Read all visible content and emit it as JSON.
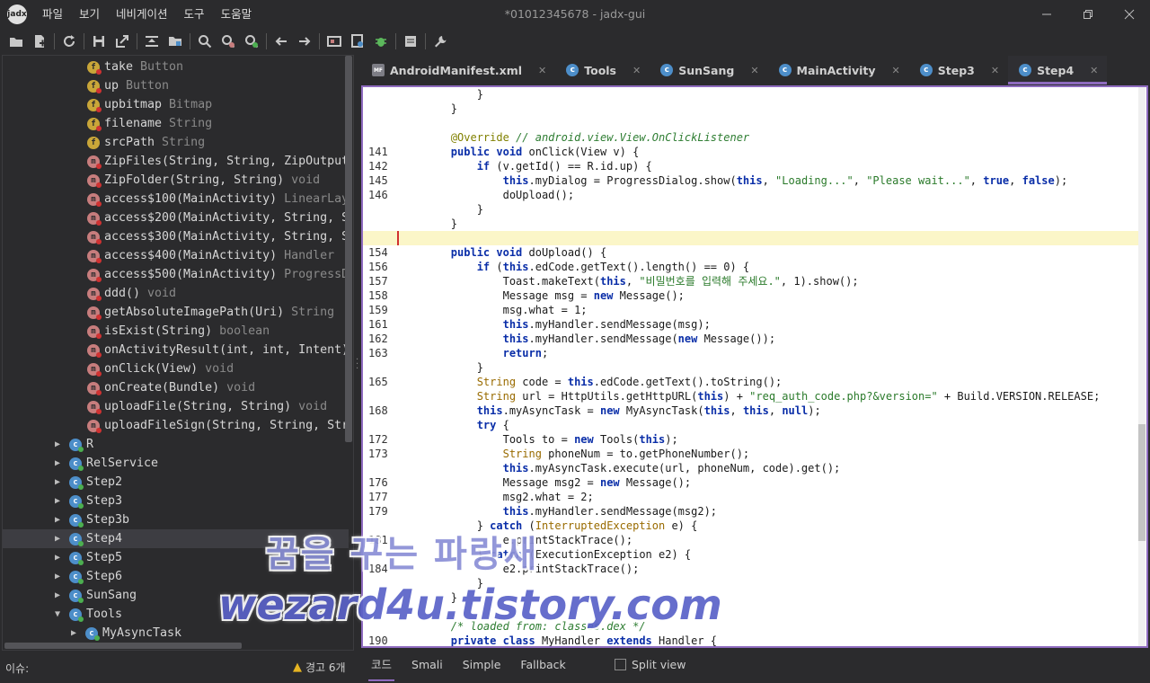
{
  "app": {
    "logo": "jadx",
    "window_title": "*01012345678 - jadx-gui",
    "menu": [
      "파일",
      "보기",
      "네비게이션",
      "도구",
      "도움말"
    ],
    "window_controls": [
      "minimize-icon",
      "restore-icon",
      "close-icon"
    ]
  },
  "toolbar": {
    "icons": [
      "open-folder-icon",
      "add-files-icon",
      "reload-icon",
      "save-icon",
      "export-icon",
      "sync-tree-icon",
      "flatten-packages-icon",
      "search-icon",
      "find-class-icon",
      "find-usage-icon",
      "back-icon",
      "forward-icon",
      "deobfuscation-icon",
      "quark-icon",
      "debugger-icon",
      "log-viewer-icon",
      "preferences-icon"
    ]
  },
  "tree": {
    "rows": [
      {
        "kind": "field",
        "name": "take",
        "type": "Button",
        "indent": 1,
        "dot": "red"
      },
      {
        "kind": "field",
        "name": "up",
        "type": "Button",
        "indent": 1,
        "dot": "red"
      },
      {
        "kind": "field",
        "name": "upbitmap",
        "type": "Bitmap",
        "indent": 1,
        "dot": "red"
      },
      {
        "kind": "field",
        "name": "filename",
        "type": "String",
        "indent": 1,
        "dot": "red"
      },
      {
        "kind": "field",
        "name": "srcPath",
        "type": "String",
        "indent": 1,
        "dot": ""
      },
      {
        "kind": "method",
        "name": "ZipFiles(String, String, ZipOutputStream)",
        "type": "",
        "indent": 1,
        "dot": "red"
      },
      {
        "kind": "method",
        "name": "ZipFolder(String, String)",
        "type": "void",
        "indent": 1,
        "dot": "red"
      },
      {
        "kind": "method",
        "name": "access$100(MainActivity)",
        "type": "LinearLayout",
        "indent": 1,
        "dot": "red"
      },
      {
        "kind": "method",
        "name": "access$200(MainActivity, String, String)",
        "type": "",
        "indent": 1,
        "dot": "red"
      },
      {
        "kind": "method",
        "name": "access$300(MainActivity, String, String)",
        "type": "",
        "indent": 1,
        "dot": "red"
      },
      {
        "kind": "method",
        "name": "access$400(MainActivity)",
        "type": "Handler",
        "indent": 1,
        "dot": "red"
      },
      {
        "kind": "method",
        "name": "access$500(MainActivity)",
        "type": "ProgressDialog",
        "indent": 1,
        "dot": "red"
      },
      {
        "kind": "method",
        "name": "ddd()",
        "type": "void",
        "indent": 1,
        "dot": "red"
      },
      {
        "kind": "method",
        "name": "getAbsoluteImagePath(Uri)",
        "type": "String",
        "indent": 1,
        "dot": "red"
      },
      {
        "kind": "method",
        "name": "isExist(String)",
        "type": "boolean",
        "indent": 1,
        "dot": "red"
      },
      {
        "kind": "method",
        "name": "onActivityResult(int, int, Intent)",
        "type": "",
        "indent": 1,
        "dot": "red"
      },
      {
        "kind": "method",
        "name": "onClick(View)",
        "type": "void",
        "indent": 1,
        "dot": "red"
      },
      {
        "kind": "method",
        "name": "onCreate(Bundle)",
        "type": "void",
        "indent": 1,
        "dot": "red"
      },
      {
        "kind": "method",
        "name": "uploadFile(String, String)",
        "type": "void",
        "indent": 1,
        "dot": "red"
      },
      {
        "kind": "method",
        "name": "uploadFileSign(String, String, String)",
        "type": "",
        "indent": 1,
        "dot": "red"
      },
      {
        "kind": "class",
        "name": "R",
        "type": "",
        "indent": 0,
        "arrow": "▶",
        "dot": "green"
      },
      {
        "kind": "class",
        "name": "RelService",
        "type": "",
        "indent": 0,
        "arrow": "▶",
        "dot": "green"
      },
      {
        "kind": "class",
        "name": "Step2",
        "type": "",
        "indent": 0,
        "arrow": "▶",
        "dot": "green"
      },
      {
        "kind": "class",
        "name": "Step3",
        "type": "",
        "indent": 0,
        "arrow": "▶",
        "dot": "green"
      },
      {
        "kind": "class",
        "name": "Step3b",
        "type": "",
        "indent": 0,
        "arrow": "▶",
        "dot": "green"
      },
      {
        "kind": "class",
        "name": "Step4",
        "type": "",
        "indent": 0,
        "arrow": "▶",
        "dot": "green",
        "selected": true
      },
      {
        "kind": "class",
        "name": "Step5",
        "type": "",
        "indent": 0,
        "arrow": "▶",
        "dot": "green"
      },
      {
        "kind": "class",
        "name": "Step6",
        "type": "",
        "indent": 0,
        "arrow": "▶",
        "dot": "green"
      },
      {
        "kind": "class",
        "name": "SunSang",
        "type": "",
        "indent": 0,
        "arrow": "▶",
        "dot": "green"
      },
      {
        "kind": "class",
        "name": "Tools",
        "type": "",
        "indent": 0,
        "arrow": "▼",
        "dot": "green"
      },
      {
        "kind": "class",
        "name": "MyAsyncTask",
        "type": "",
        "indent": 1,
        "arrow": "▶",
        "dot": "green"
      }
    ]
  },
  "tabs": [
    {
      "label": "AndroidManifest.xml",
      "icon": "mf",
      "active": false
    },
    {
      "label": "Tools",
      "icon": "c",
      "active": false
    },
    {
      "label": "SunSang",
      "icon": "c",
      "active": false
    },
    {
      "label": "MainActivity",
      "icon": "c",
      "active": false
    },
    {
      "label": "Step3",
      "icon": "c",
      "active": false
    },
    {
      "label": "Step4",
      "icon": "c",
      "active": true
    }
  ],
  "code": {
    "highlighted_line_index": 10,
    "lines": [
      {
        "ln": "",
        "tokens": [
          [
            "",
            "            }"
          ]
        ]
      },
      {
        "ln": "",
        "tokens": [
          [
            "",
            "        }"
          ]
        ]
      },
      {
        "ln": "",
        "tokens": [
          [
            "",
            ""
          ]
        ]
      },
      {
        "ln": "",
        "tokens": [
          [
            "",
            "        "
          ],
          [
            "ann",
            "@Override"
          ],
          [
            "",
            " "
          ],
          [
            "cmt",
            "// android.view.View.OnClickListener"
          ]
        ]
      },
      {
        "ln": "141",
        "tokens": [
          [
            "",
            "        "
          ],
          [
            "kw",
            "public void"
          ],
          [
            "",
            " onClick(View v) {"
          ]
        ]
      },
      {
        "ln": "142",
        "tokens": [
          [
            "",
            "            "
          ],
          [
            "kw",
            "if"
          ],
          [
            "",
            " (v.getId() == R.id.up) {"
          ]
        ]
      },
      {
        "ln": "145",
        "tokens": [
          [
            "",
            "                "
          ],
          [
            "kw",
            "this"
          ],
          [
            "",
            ".myDialog = ProgressDialog.show("
          ],
          [
            "kw",
            "this"
          ],
          [
            "",
            ", "
          ],
          [
            "str",
            "\"Loading...\""
          ],
          [
            "",
            ", "
          ],
          [
            "str",
            "\"Please wait...\""
          ],
          [
            "",
            ", "
          ],
          [
            "kw",
            "true"
          ],
          [
            "",
            ", "
          ],
          [
            "kw",
            "false"
          ],
          [
            "",
            ");"
          ]
        ]
      },
      {
        "ln": "146",
        "tokens": [
          [
            "",
            "                doUpload();"
          ]
        ]
      },
      {
        "ln": "",
        "tokens": [
          [
            "",
            "            }"
          ]
        ]
      },
      {
        "ln": "",
        "tokens": [
          [
            "",
            "        }"
          ]
        ]
      },
      {
        "ln": "",
        "tokens": [
          [
            "",
            ""
          ]
        ]
      },
      {
        "ln": "154",
        "tokens": [
          [
            "",
            "        "
          ],
          [
            "kw",
            "public void"
          ],
          [
            "",
            " doUpload() {"
          ]
        ]
      },
      {
        "ln": "156",
        "tokens": [
          [
            "",
            "            "
          ],
          [
            "kw",
            "if"
          ],
          [
            "",
            " ("
          ],
          [
            "kw",
            "this"
          ],
          [
            "",
            ".edCode.getText().length() == 0) {"
          ]
        ]
      },
      {
        "ln": "157",
        "tokens": [
          [
            "",
            "                Toast.makeText("
          ],
          [
            "kw",
            "this"
          ],
          [
            "",
            ", "
          ],
          [
            "str",
            "\"비밀번호를 입력해 주세요.\""
          ],
          [
            "",
            ", 1).show();"
          ]
        ]
      },
      {
        "ln": "158",
        "tokens": [
          [
            "",
            "                Message msg = "
          ],
          [
            "kw",
            "new"
          ],
          [
            "",
            " Message();"
          ]
        ]
      },
      {
        "ln": "159",
        "tokens": [
          [
            "",
            "                msg.what = 1;"
          ]
        ]
      },
      {
        "ln": "161",
        "tokens": [
          [
            "",
            "                "
          ],
          [
            "kw",
            "this"
          ],
          [
            "",
            ".myHandler.sendMessage(msg);"
          ]
        ]
      },
      {
        "ln": "162",
        "tokens": [
          [
            "",
            "                "
          ],
          [
            "kw",
            "this"
          ],
          [
            "",
            ".myHandler.sendMessage("
          ],
          [
            "kw",
            "new"
          ],
          [
            "",
            " Message());"
          ]
        ]
      },
      {
        "ln": "163",
        "tokens": [
          [
            "",
            "                "
          ],
          [
            "kw",
            "return"
          ],
          [
            "",
            ";"
          ]
        ]
      },
      {
        "ln": "",
        "tokens": [
          [
            "",
            "            }"
          ]
        ]
      },
      {
        "ln": "165",
        "tokens": [
          [
            "",
            "            "
          ],
          [
            "typ",
            "String"
          ],
          [
            "",
            " code = "
          ],
          [
            "kw",
            "this"
          ],
          [
            "",
            ".edCode.getText().toString();"
          ]
        ]
      },
      {
        "ln": "",
        "tokens": [
          [
            "",
            "            "
          ],
          [
            "typ",
            "String"
          ],
          [
            "",
            " url = HttpUtils.getHttpURL("
          ],
          [
            "kw",
            "this"
          ],
          [
            "",
            ") + "
          ],
          [
            "str",
            "\"req_auth_code.php?&version=\""
          ],
          [
            "",
            " + Build.VERSION.RELEASE;"
          ]
        ]
      },
      {
        "ln": "168",
        "tokens": [
          [
            "",
            "            "
          ],
          [
            "kw",
            "this"
          ],
          [
            "",
            ".myAsyncTask = "
          ],
          [
            "kw",
            "new"
          ],
          [
            "",
            " MyAsyncTask("
          ],
          [
            "kw",
            "this"
          ],
          [
            "",
            ", "
          ],
          [
            "kw",
            "this"
          ],
          [
            "",
            ", "
          ],
          [
            "kw",
            "null"
          ],
          [
            "",
            ");"
          ]
        ]
      },
      {
        "ln": "",
        "tokens": [
          [
            "",
            "            "
          ],
          [
            "kw",
            "try"
          ],
          [
            "",
            " {"
          ]
        ]
      },
      {
        "ln": "172",
        "tokens": [
          [
            "",
            "                Tools to = "
          ],
          [
            "kw",
            "new"
          ],
          [
            "",
            " Tools("
          ],
          [
            "kw",
            "this"
          ],
          [
            "",
            ");"
          ]
        ]
      },
      {
        "ln": "173",
        "tokens": [
          [
            "",
            "                "
          ],
          [
            "typ",
            "String"
          ],
          [
            "",
            " phoneNum = to.getPhoneNumber();"
          ]
        ]
      },
      {
        "ln": "",
        "tokens": [
          [
            "",
            "                "
          ],
          [
            "kw",
            "this"
          ],
          [
            "",
            ".myAsyncTask.execute(url, phoneNum, code).get();"
          ]
        ]
      },
      {
        "ln": "176",
        "tokens": [
          [
            "",
            "                Message msg2 = "
          ],
          [
            "kw",
            "new"
          ],
          [
            "",
            " Message();"
          ]
        ]
      },
      {
        "ln": "177",
        "tokens": [
          [
            "",
            "                msg2.what = 2;"
          ]
        ]
      },
      {
        "ln": "179",
        "tokens": [
          [
            "",
            "                "
          ],
          [
            "kw",
            "this"
          ],
          [
            "",
            ".myHandler.sendMessage(msg2);"
          ]
        ]
      },
      {
        "ln": "",
        "tokens": [
          [
            "",
            "            } "
          ],
          [
            "kw",
            "catch"
          ],
          [
            "",
            " ("
          ],
          [
            "typ",
            "InterruptedException"
          ],
          [
            "",
            " e) {"
          ]
        ]
      },
      {
        "ln": "181",
        "tokens": [
          [
            "",
            "                e.printStackTrace();"
          ]
        ]
      },
      {
        "ln": "",
        "tokens": [
          [
            "",
            "            } "
          ],
          [
            "kw",
            "catch"
          ],
          [
            "",
            " (ExecutionException e2) {"
          ]
        ]
      },
      {
        "ln": "184",
        "tokens": [
          [
            "",
            "                e2.printStackTrace();"
          ]
        ]
      },
      {
        "ln": "",
        "tokens": [
          [
            "",
            "            }"
          ]
        ]
      },
      {
        "ln": "",
        "tokens": [
          [
            "",
            "        }"
          ]
        ]
      },
      {
        "ln": "",
        "tokens": [
          [
            "",
            ""
          ]
        ]
      },
      {
        "ln": "",
        "tokens": [
          [
            "",
            "        "
          ],
          [
            "cmt",
            "/* loaded from: classes.dex */"
          ]
        ]
      },
      {
        "ln": "190",
        "tokens": [
          [
            "",
            "        "
          ],
          [
            "kw",
            "private class"
          ],
          [
            "",
            " MyHandler "
          ],
          [
            "kw",
            "extends"
          ],
          [
            "",
            " Handler {"
          ]
        ]
      }
    ]
  },
  "status": {
    "issues_label": "이슈:",
    "warnings": "경고 6개",
    "mode_tabs": [
      {
        "label": "코드",
        "active": true
      },
      {
        "label": "Smali",
        "active": false
      },
      {
        "label": "Simple",
        "active": false
      },
      {
        "label": "Fallback",
        "active": false
      }
    ],
    "split_view_label": "Split view",
    "split_view_checked": false
  },
  "watermark": {
    "line1": "꿈을 꾸는 파랑새",
    "line2": "wezard4u.tistory.com"
  },
  "colors": {
    "accent": "#8e6bbf",
    "highlight_line": "#fbf6c8",
    "keyword": "#0a2ea8",
    "string": "#2a7a2a"
  }
}
